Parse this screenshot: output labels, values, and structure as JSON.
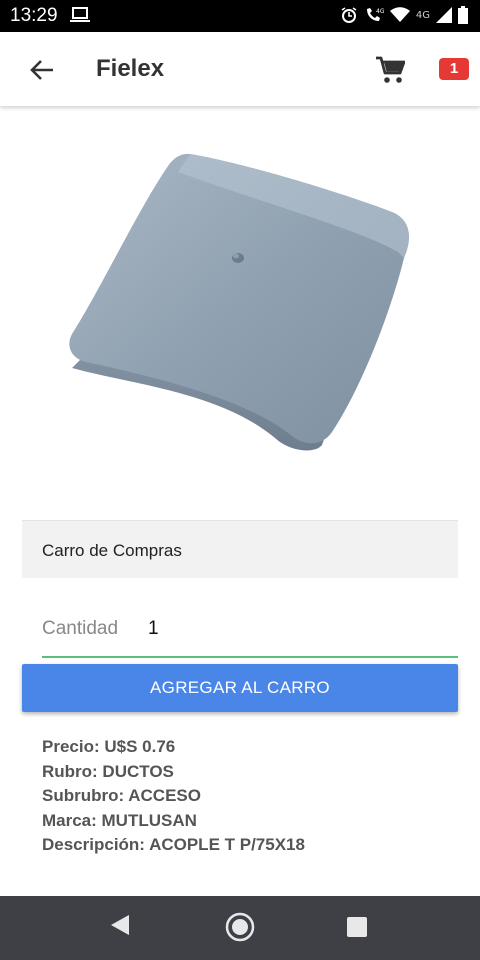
{
  "status_bar": {
    "time": "13:29",
    "network_label": "4G",
    "secondary_network_label": "4G"
  },
  "app_bar": {
    "title": "Fielex",
    "cart_count": "1"
  },
  "product": {
    "image_icon": "product-photo-gray-square-cap"
  },
  "cart_section": {
    "title": "Carro de Compras"
  },
  "quantity": {
    "label": "Cantidad",
    "value": "1"
  },
  "add_button": {
    "label": "AGREGAR AL CARRO"
  },
  "details": {
    "precio": "Precio: U$S 0.76",
    "rubro": "Rubro: DUCTOS",
    "subrubro": "Subrubro: ACCESO",
    "marca": "Marca: MUTLUSAN",
    "descripcion": "Descripción: ACOPLE T P/75X18"
  },
  "colors": {
    "primary_button": "#4a86e8",
    "badge": "#e53935",
    "input_underline": "#5cbf7d",
    "nav_bar": "#3e4046"
  }
}
